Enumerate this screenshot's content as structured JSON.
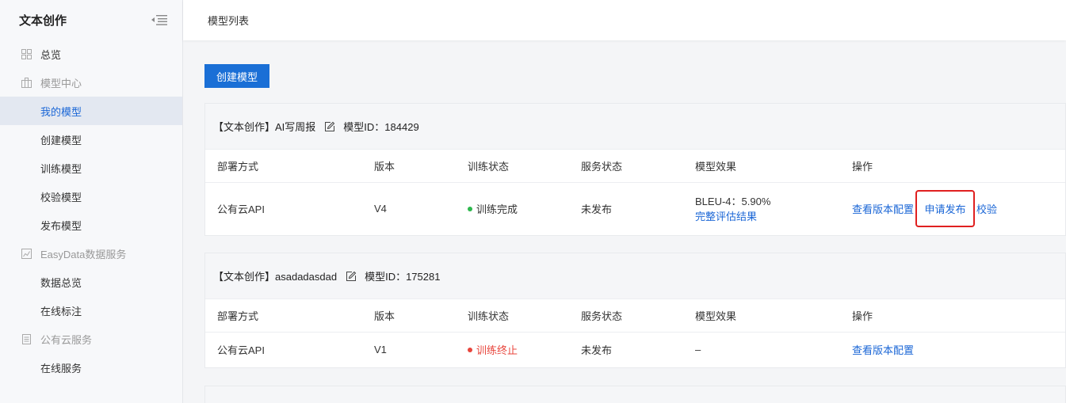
{
  "sidebar": {
    "title": "文本创作",
    "items": [
      {
        "label": "总览",
        "type": "top",
        "icon": "grid-icon"
      },
      {
        "label": "模型中心",
        "type": "group",
        "icon": "briefcase-icon"
      },
      {
        "label": "我的模型",
        "type": "sub",
        "active": true
      },
      {
        "label": "创建模型",
        "type": "sub"
      },
      {
        "label": "训练模型",
        "type": "sub"
      },
      {
        "label": "校验模型",
        "type": "sub"
      },
      {
        "label": "发布模型",
        "type": "sub"
      },
      {
        "label": "EasyData数据服务",
        "type": "group",
        "icon": "chart-icon"
      },
      {
        "label": "数据总览",
        "type": "sub"
      },
      {
        "label": "在线标注",
        "type": "sub"
      },
      {
        "label": "公有云服务",
        "type": "group",
        "icon": "list-icon"
      },
      {
        "label": "在线服务",
        "type": "sub"
      }
    ]
  },
  "topbar": {
    "breadcrumb": "模型列表"
  },
  "main": {
    "create_button": "创建模型",
    "columns": [
      "部署方式",
      "版本",
      "训练状态",
      "服务状态",
      "模型效果",
      "操作"
    ],
    "models": [
      {
        "name": "【文本创作】AI写周报",
        "id_label": "模型ID：184429",
        "row": {
          "deploy": "公有云API",
          "version": "V4",
          "train_status": "训练完成",
          "train_status_color": "#2db84d",
          "service_status": "未发布",
          "effect_line1": "BLEU-4：5.90%",
          "effect_link": "完整评估结果",
          "ops": [
            "查看版本配置",
            "申请发布",
            "校验"
          ]
        }
      },
      {
        "name": "【文本创作】asadadasdad",
        "id_label": "模型ID：175281",
        "row": {
          "deploy": "公有云API",
          "version": "V1",
          "train_status": "训练终止",
          "train_status_color": "#e8453c",
          "service_status": "未发布",
          "effect_line1": "–",
          "ops": [
            "查看版本配置"
          ]
        }
      }
    ]
  },
  "colors": {
    "accent": "#1a6fd6",
    "link": "#1a66d6",
    "highlight_border": "#e02020"
  }
}
